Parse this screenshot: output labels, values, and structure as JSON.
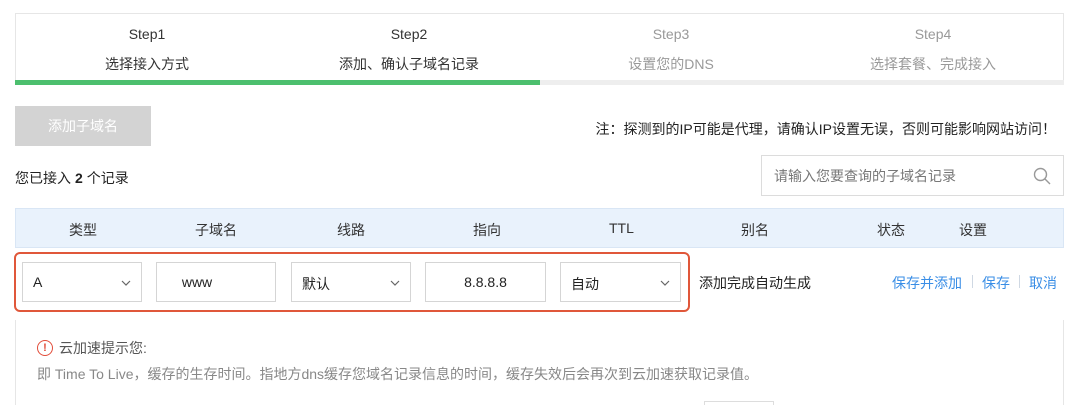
{
  "steps": [
    {
      "num": "Step1",
      "desc": "选择接入方式",
      "state": "active"
    },
    {
      "num": "Step2",
      "desc": "添加、确认子域名记录",
      "state": "active"
    },
    {
      "num": "Step3",
      "desc": "设置您的DNS",
      "state": "inactive"
    },
    {
      "num": "Step4",
      "desc": "选择套餐、完成接入",
      "state": "inactive"
    }
  ],
  "progress": {
    "completed_steps": 2,
    "total_steps": 4,
    "color": "#4cbf6e"
  },
  "toolbar": {
    "add_subdomain_label": "添加子域名",
    "notice": "注：探测到的IP可能是代理，请确认IP设置无误，否则可能影响网站访问！"
  },
  "summary": {
    "prefix": "您已接入",
    "count": "2",
    "suffix": "个记录"
  },
  "search": {
    "placeholder": "请输入您要查询的子域名记录",
    "value": ""
  },
  "table": {
    "headers": [
      "类型",
      "子域名",
      "线路",
      "指向",
      "TTL",
      "别名",
      "状态",
      "设置"
    ],
    "edit_row": {
      "type": "A",
      "subdomain": "www",
      "line": "默认",
      "target": "8.8.8.8",
      "ttl": "自动",
      "alias": "添加完成自动生成",
      "actions": [
        "保存并添加",
        "保存",
        "取消"
      ]
    }
  },
  "tip": {
    "title": "云加速提示您:",
    "body": "即 Time To Live，缓存的生存时间。指地方dns缓存您域名记录信息的时间，缓存失效后会再次到云加速获取记录值。"
  },
  "colors": {
    "highlight_border": "#e0573a",
    "link": "#3a8ee6",
    "header_bg": "#e9f2fc",
    "warning": "#e24d3a"
  }
}
